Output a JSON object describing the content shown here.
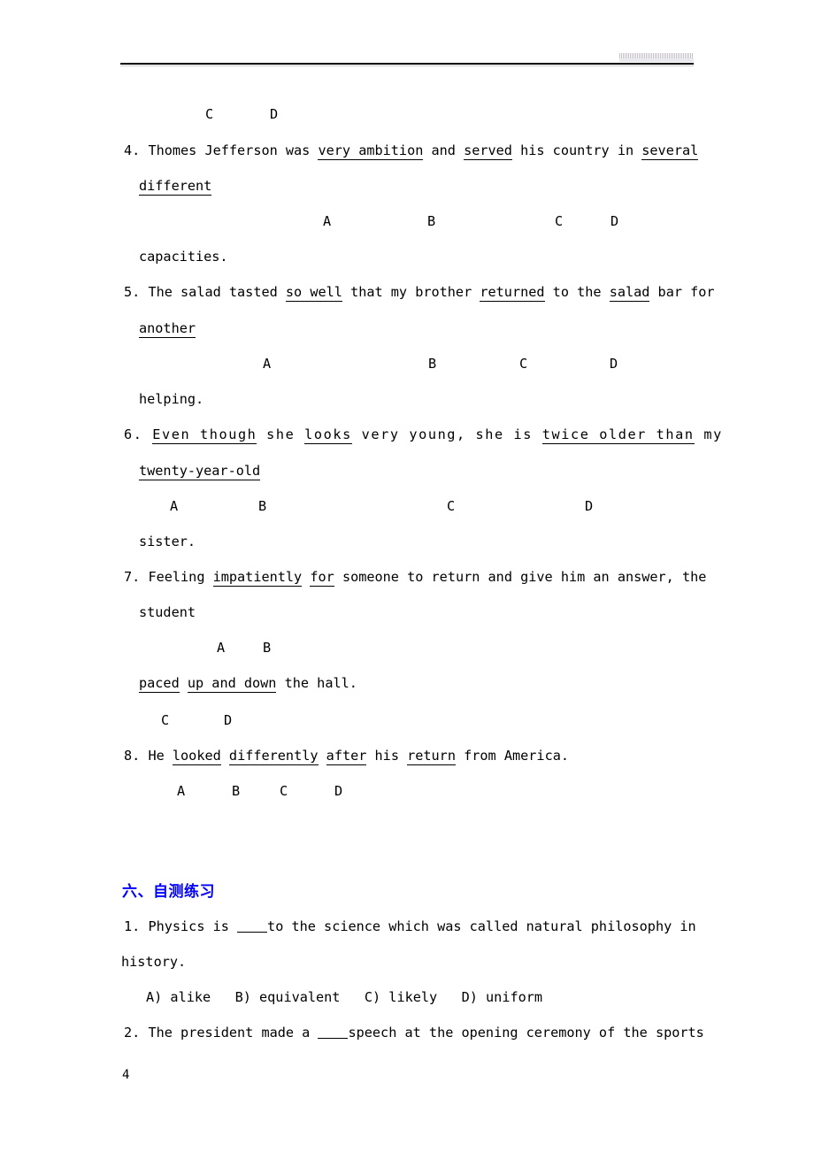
{
  "page": {
    "number": "4",
    "heading_color": "#0000ff",
    "text_color": "#000000",
    "background": "#ffffff"
  },
  "header": {
    "rule": "horizontal-rule",
    "artifact": "faint-watermark-remnant"
  },
  "section": {
    "title": "六、自测练习"
  },
  "error_correction": {
    "markers_above": {
      "c": "C",
      "d": "D"
    },
    "items": [
      {
        "number": "4.",
        "segments": [
          {
            "text": "Thomes Jefferson was ",
            "underline": false
          },
          {
            "text": "very ambition",
            "underline": true
          },
          {
            "text": " and ",
            "underline": false
          },
          {
            "text": "served",
            "underline": true
          },
          {
            "text": " his country in ",
            "underline": false
          },
          {
            "text": "several",
            "underline": true
          }
        ],
        "wrap_segments": [
          {
            "text": "different",
            "underline": true
          }
        ],
        "tail": "capacities.",
        "markers": [
          "A",
          "B",
          "C",
          "D"
        ]
      },
      {
        "number": "5.",
        "segments": [
          {
            "text": "The salad tasted ",
            "underline": false
          },
          {
            "text": "so well",
            "underline": true
          },
          {
            "text": " that my brother ",
            "underline": false
          },
          {
            "text": "returned",
            "underline": true
          },
          {
            "text": " to the ",
            "underline": false
          },
          {
            "text": "salad",
            "underline": true
          },
          {
            "text": " bar for",
            "underline": false
          }
        ],
        "wrap_segments": [
          {
            "text": "another",
            "underline": true
          }
        ],
        "tail": "helping.",
        "markers": [
          "A",
          "B",
          "C",
          "D"
        ]
      },
      {
        "number": "6.",
        "segments": [
          {
            "text": "Even though",
            "underline": true
          },
          {
            "text": " she ",
            "underline": false
          },
          {
            "text": "looks",
            "underline": true
          },
          {
            "text": " very young, she is ",
            "underline": false
          },
          {
            "text": "twice older than",
            "underline": true
          },
          {
            "text": " my",
            "underline": false
          }
        ],
        "wrap_segments": [
          {
            "text": "twenty-year-old",
            "underline": true
          }
        ],
        "tail": "sister.",
        "markers": [
          "A",
          "B",
          "C",
          "D"
        ]
      },
      {
        "number": "7.",
        "segments": [
          {
            "text": "Feeling ",
            "underline": false
          },
          {
            "text": "impatiently",
            "underline": true
          },
          {
            "text": " ",
            "underline": false
          },
          {
            "text": "for",
            "underline": true
          },
          {
            "text": " someone to return and give him an answer, the",
            "underline": false
          }
        ],
        "wrap_segments": [
          {
            "text": "student",
            "underline": false
          }
        ],
        "markers_mid": [
          "A",
          "B"
        ],
        "tail_segments": [
          {
            "text": "paced",
            "underline": true
          },
          {
            "text": " ",
            "underline": false
          },
          {
            "text": "up and down",
            "underline": true
          },
          {
            "text": " the hall.",
            "underline": false
          }
        ],
        "markers": [
          "C",
          "D"
        ]
      },
      {
        "number": "8.",
        "segments": [
          {
            "text": "He ",
            "underline": false
          },
          {
            "text": "looked",
            "underline": true
          },
          {
            "text": " ",
            "underline": false
          },
          {
            "text": "differently",
            "underline": true
          },
          {
            "text": " ",
            "underline": false
          },
          {
            "text": "after",
            "underline": true
          },
          {
            "text": " his ",
            "underline": false
          },
          {
            "text": "return",
            "underline": true
          },
          {
            "text": " from America.",
            "underline": false
          }
        ],
        "markers": [
          "A",
          "B",
          "C",
          "D"
        ]
      }
    ]
  },
  "self_test": {
    "questions": [
      {
        "number": "1.",
        "text_before": "Physics is ",
        "blank": "____",
        "text_after": "to the science which was called natural philosophy in",
        "wrap": "history.",
        "options": "A) alike   B) equivalent   C) likely   D) uniform"
      },
      {
        "number": "2.",
        "text_before": "The president made a ",
        "blank": "____",
        "text_after": "speech at the opening ceremony of the sports"
      }
    ]
  },
  "markers": {
    "row_item4_prev": [
      "C",
      "D"
    ],
    "row_item4": [
      "A",
      "B",
      "C",
      "D"
    ],
    "row_item5": [
      "A",
      "B",
      "C",
      "D"
    ],
    "row_item6": [
      "A",
      "B",
      "C",
      "D"
    ],
    "row_item7_ab": [
      "A",
      "B"
    ],
    "row_item7_cd": [
      "C",
      "D"
    ],
    "row_item8": [
      "A",
      "B",
      "C",
      "D"
    ]
  }
}
